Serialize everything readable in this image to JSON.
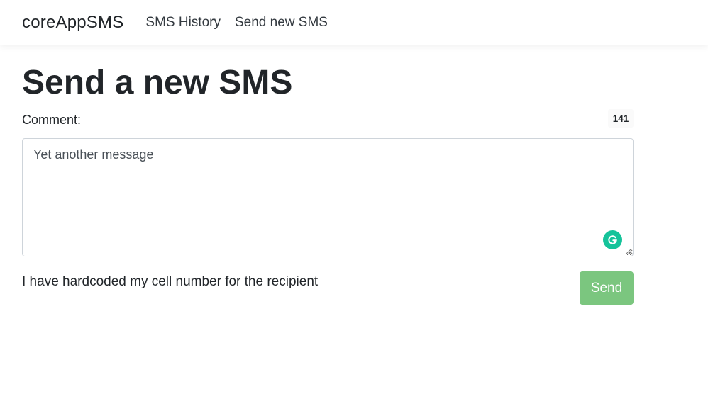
{
  "navbar": {
    "brand": "coreAppSMS",
    "links": [
      {
        "label": "SMS History"
      },
      {
        "label": "Send new SMS"
      }
    ]
  },
  "main": {
    "title": "Send a new SMS",
    "comment_label": "Comment:",
    "char_counter": "141",
    "comment_value": "Yet another message",
    "hint": "I have hardcoded my cell number for the recipient",
    "send_label": "Send"
  },
  "icons": {
    "grammarly": "grammarly-icon",
    "resize": "resize-handle-icon"
  },
  "colors": {
    "send_button": "#7bc67f",
    "grammarly": "#15c39a"
  }
}
